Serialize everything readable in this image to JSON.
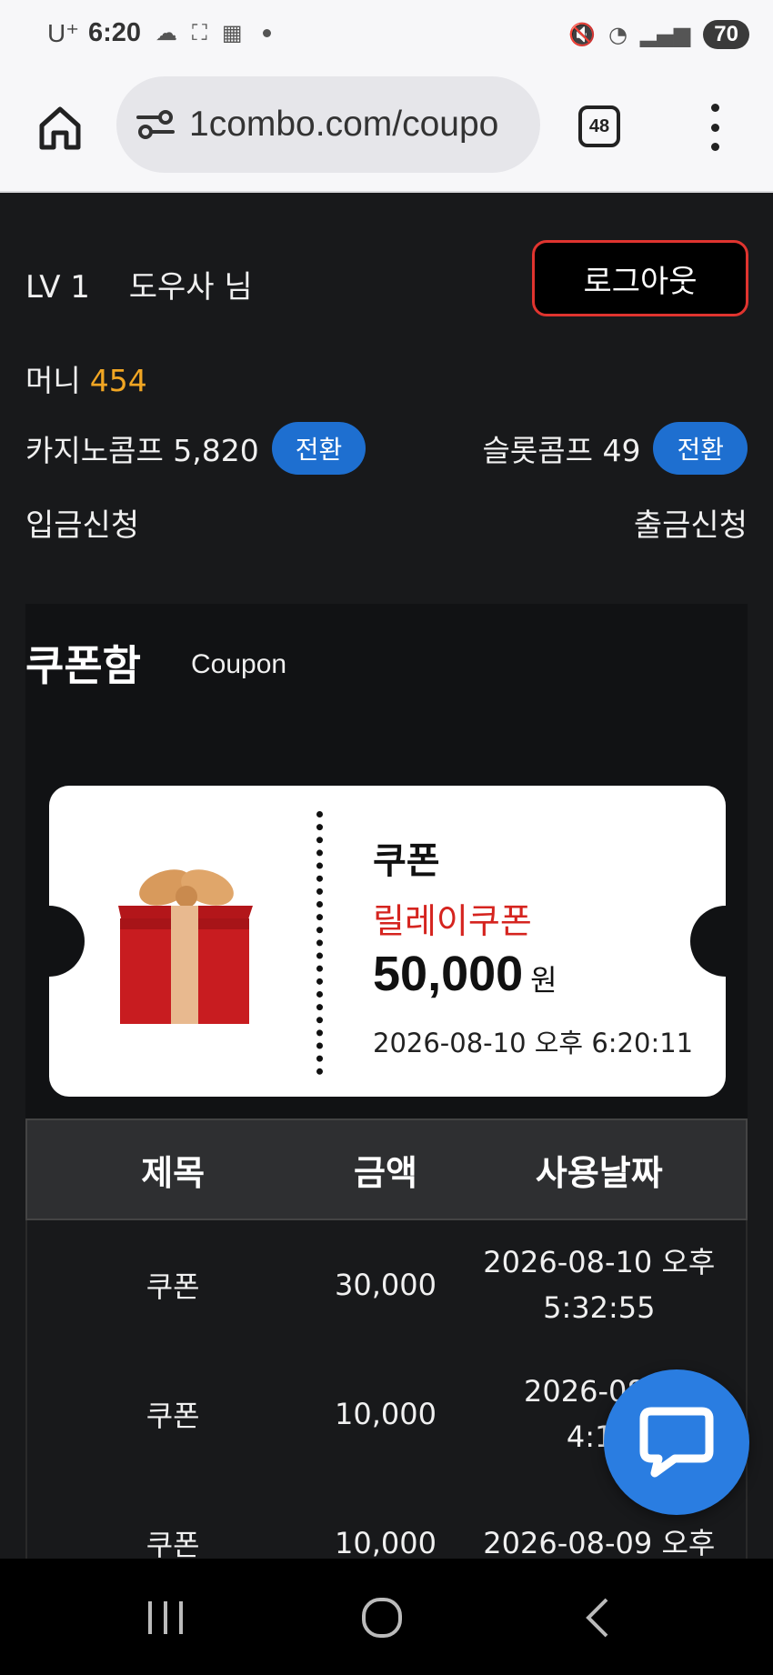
{
  "status_bar": {
    "carrier": "U⁺",
    "time": "6:20",
    "battery": "70"
  },
  "browser": {
    "url": "1combo.com/coupo",
    "tab_count": "48"
  },
  "user": {
    "level": "LV 1",
    "name": "도우사 님",
    "logout_label": "로그아웃"
  },
  "balance": {
    "money_label": "머니",
    "money_value": "454",
    "casino_comp_label": "카지노콤프 5,820",
    "slot_comp_label": "슬롯콤프 49",
    "convert_label": "전환",
    "deposit_label": "입금신청",
    "withdraw_label": "출금신청"
  },
  "coupon_box": {
    "title": "쿠폰함",
    "subtitle": "Coupon",
    "ticket": {
      "name": "쿠폰",
      "type": "릴레이쿠폰",
      "amount": "50,000",
      "unit": "원",
      "date": "2026-08-10 오후 6:20:11"
    }
  },
  "table": {
    "headers": [
      "제목",
      "금액",
      "사용날짜"
    ],
    "rows": [
      {
        "title": "쿠폰",
        "amount": "30,000",
        "date_line1": "2026-08-10 오후",
        "date_line2": "5:32:55"
      },
      {
        "title": "쿠폰",
        "amount": "10,000",
        "date_line1": "2026-08-1",
        "date_line2": "4:17"
      },
      {
        "title": "쿠폰",
        "amount": "10,000",
        "date_line1": "2026-08-09 오후",
        "date_line2": ""
      }
    ]
  },
  "colors": {
    "accent_blue": "#1e6fd0",
    "money_gold": "#f1a623",
    "logout_red": "#e0342f",
    "coupon_red": "#d5241f"
  }
}
